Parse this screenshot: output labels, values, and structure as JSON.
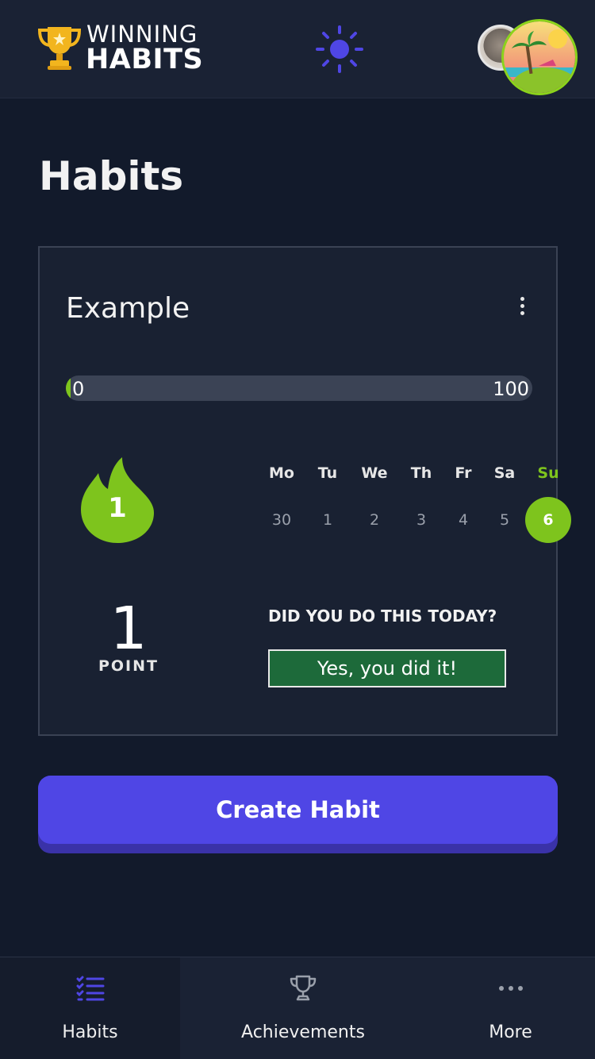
{
  "header": {
    "logo_line1": "WINNING",
    "logo_line2": "HABITS",
    "theme_icon": "sun-icon",
    "avatars": [
      "avatar-photo",
      "avatar-beach"
    ]
  },
  "page": {
    "title": "Habits"
  },
  "habit_card": {
    "title": "Example",
    "menu_icon": "kebab-menu-icon",
    "progress": {
      "value": 0,
      "min_label": "0",
      "max_label": "100",
      "fill_fraction": 0.01
    },
    "streak": {
      "value": "1",
      "icon": "flame-icon"
    },
    "week": {
      "days": [
        {
          "name": "Mo",
          "num": "30",
          "today": false
        },
        {
          "name": "Tu",
          "num": "1",
          "today": false
        },
        {
          "name": "We",
          "num": "2",
          "today": false
        },
        {
          "name": "Th",
          "num": "3",
          "today": false
        },
        {
          "name": "Fr",
          "num": "4",
          "today": false
        },
        {
          "name": "Sa",
          "num": "5",
          "today": false
        },
        {
          "name": "Su",
          "num": "6",
          "today": true
        }
      ]
    },
    "points": {
      "value": "1",
      "label": "POINT"
    },
    "question": "DID YOU DO THIS TODAY?",
    "done_button": "Yes, you did it!"
  },
  "create_button": "Create Habit",
  "bottom_nav": {
    "items": [
      {
        "label": "Habits",
        "icon": "habits-list-icon",
        "active": true
      },
      {
        "label": "Achievements",
        "icon": "trophy-icon",
        "active": false
      },
      {
        "label": "More",
        "icon": "more-dots-icon",
        "active": false
      }
    ]
  },
  "colors": {
    "accent": "#4f46e5",
    "success": "#7ec41d",
    "background": "#121a2b",
    "surface": "#1a2234",
    "done_button": "#1d6a3a"
  }
}
